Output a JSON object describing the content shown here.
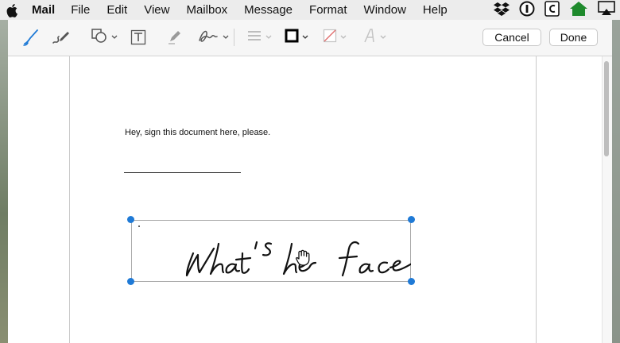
{
  "menubar": {
    "app_name": "Mail",
    "items": [
      "File",
      "Edit",
      "View",
      "Mailbox",
      "Message",
      "Format",
      "Window",
      "Help"
    ],
    "status_icons": [
      "dropbox-icon",
      "1password-icon",
      "clipboard-c-icon",
      "home-icon",
      "airplay-icon"
    ]
  },
  "toolbar": {
    "tools": [
      "sketch-icon",
      "draw-icon",
      "shapes-icon",
      "text-box-icon",
      "highlight-icon",
      "signature-icon",
      "line-style-icon",
      "border-color-icon",
      "fill-color-icon",
      "text-style-icon"
    ],
    "cancel_label": "Cancel",
    "done_label": "Done"
  },
  "document": {
    "instruction_text": "Hey, sign this document here, please.",
    "signature": "What's her face"
  },
  "colors": {
    "accent": "#1f7ad6",
    "menubar_bg": "#ececec",
    "toolbar_bg": "#f6f6f6"
  }
}
